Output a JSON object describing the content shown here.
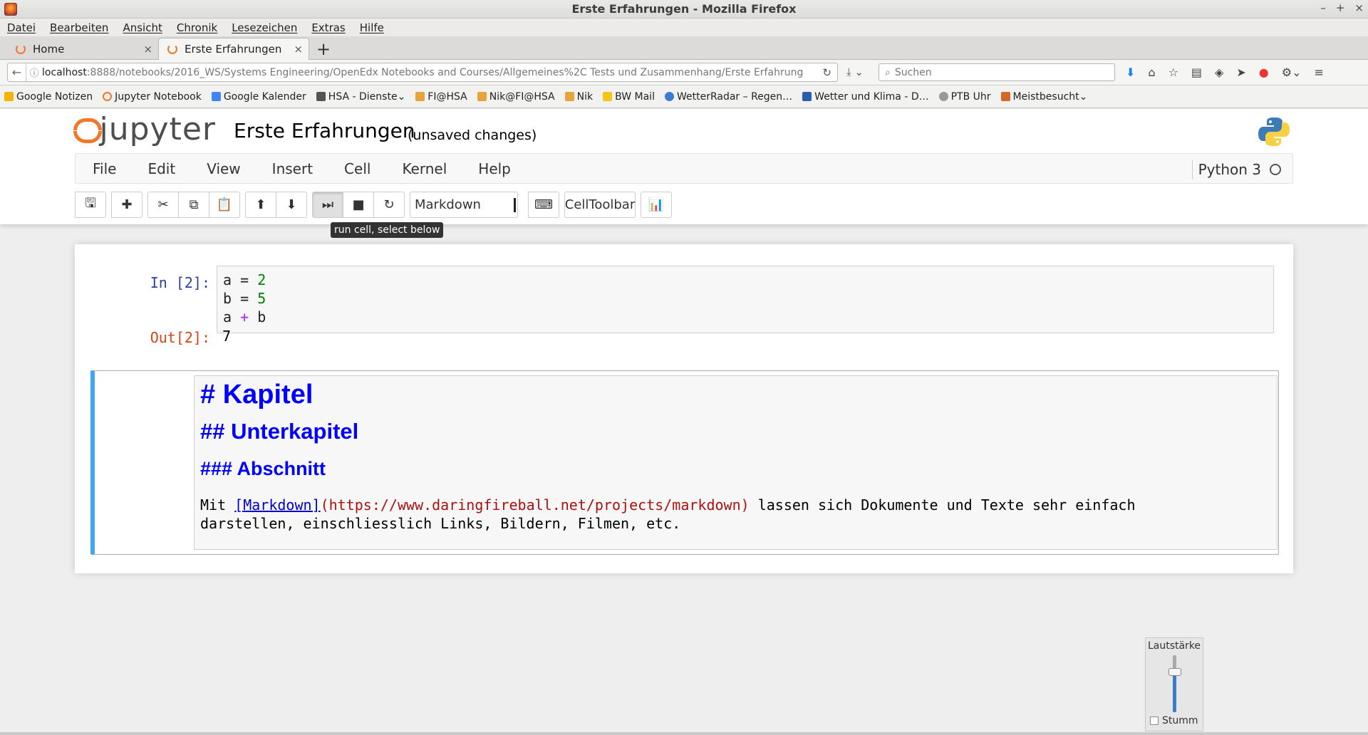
{
  "window": {
    "title": "Erste Erfahrungen - Mozilla Firefox",
    "controls": [
      "–",
      "+",
      "×"
    ]
  },
  "browser_menu": [
    "Datei",
    "Bearbeiten",
    "Ansicht",
    "Chronik",
    "Lesezeichen",
    "Extras",
    "Hilfe"
  ],
  "tabs": [
    {
      "label": "Home",
      "close": "×"
    },
    {
      "label": "Erste Erfahrungen",
      "close": "×"
    }
  ],
  "new_tab": "+",
  "address": {
    "host": "localhost",
    "path": ":8888/notebooks/2016_WS/Systems Engineering/OpenEdx Notebooks and Courses/Allgemeines%2C Tests und Zusammenhang/Erste Erfahrung",
    "reload_icon": "reload-icon"
  },
  "search": {
    "placeholder": "Suchen"
  },
  "bookmarks": [
    {
      "label": "Google Notizen",
      "color": "#f4b400"
    },
    {
      "label": "Jupyter Notebook",
      "color": "#f37726"
    },
    {
      "label": "Google Kalender",
      "color": "#4285f4"
    },
    {
      "label": "HSA - Dienste",
      "color": "#555555"
    },
    {
      "label": "FI@HSA",
      "color": "#e8a33d"
    },
    {
      "label": "Nik@FI@HSA",
      "color": "#e8a33d"
    },
    {
      "label": "Nik",
      "color": "#e8a33d"
    },
    {
      "label": "BW Mail",
      "color": "#f5c518"
    },
    {
      "label": "WetterRadar – Regen…",
      "color": "#3a7ccf"
    },
    {
      "label": "Wetter und Klima - D…",
      "color": "#2a5db0"
    },
    {
      "label": "PTB Uhr",
      "color": "#999999"
    },
    {
      "label": "Meistbesucht",
      "color": "#d06a2a"
    }
  ],
  "jupyter": {
    "logo_text": "jupyter",
    "notebook_name": "Erste Erfahrungen",
    "status": "(unsaved changes)",
    "menu": [
      "File",
      "Edit",
      "View",
      "Insert",
      "Cell",
      "Kernel",
      "Help"
    ],
    "kernel": "Python 3",
    "cell_type": "Markdown",
    "celltoolbar": "CellToolbar",
    "tooltip": "run cell, select below"
  },
  "code_cell": {
    "in_prompt": "In [2]:",
    "out_prompt": "Out[2]:",
    "lines": [
      {
        "var": "a",
        "op": "=",
        "val": "2"
      },
      {
        "var": "b",
        "op": "=",
        "val": "5"
      },
      {
        "var": "a",
        "op": "+",
        "val": "b"
      }
    ],
    "output": "7"
  },
  "markdown_cell": {
    "h1": "# Kapitel",
    "h2": "## Unterkapitel",
    "h3": "### Abschnitt",
    "text_before": "Mit ",
    "link_text": "[Markdown]",
    "link_url": "(https://www.daringfireball.net/projects/markdown)",
    "text_after": " lassen sich Dokumente und Texte sehr einfach",
    "line2": "darstellen, einschliesslich Links, Bildern, Filmen, etc."
  },
  "volume": {
    "title": "Lautstärke",
    "mute_label": "Stumm",
    "level": 0.7
  }
}
